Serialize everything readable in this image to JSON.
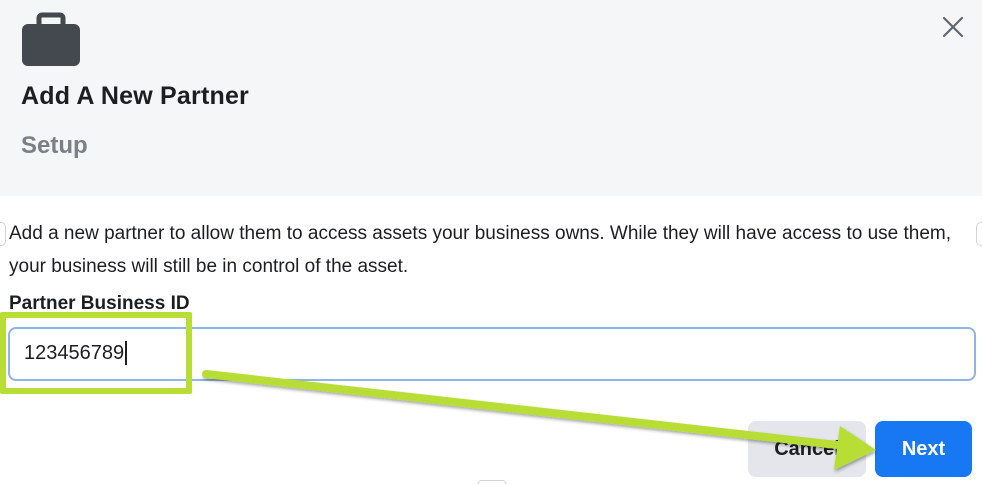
{
  "dialog": {
    "title": "Add A New Partner",
    "subtitle": "Setup",
    "icon": "briefcase-icon",
    "close_icon": "close-icon"
  },
  "body": {
    "description": "Add a new partner to allow them to access assets your business owns. While they will have access to use them, your business will still be in control of the asset."
  },
  "field": {
    "label": "Partner Business ID",
    "value": "123456789"
  },
  "footer": {
    "cancel_label": "Cancel",
    "next_label": "Next"
  },
  "annotation": {
    "highlight_color": "#b8dd35",
    "arrow_color": "#b8dd35"
  },
  "colors": {
    "primary": "#1877f2",
    "header_bg": "#f5f6f7",
    "input_focus_border": "#8fb4e6"
  }
}
